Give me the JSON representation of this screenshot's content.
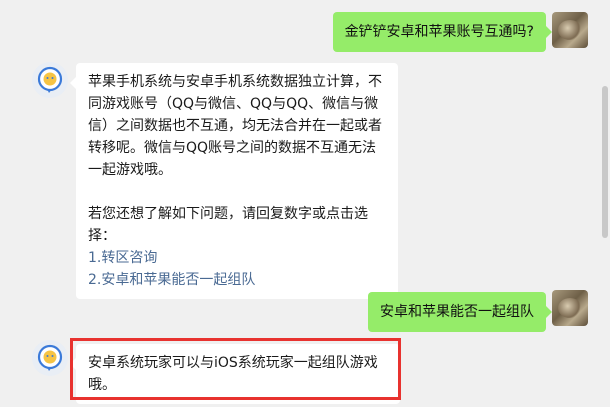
{
  "conversation": {
    "messages": [
      {
        "sender": "user",
        "text": "金铲铲安卓和苹果账号互通吗?"
      },
      {
        "sender": "bot",
        "paragraph": "苹果手机系统与安卓手机系统数据独立计算，不同游戏账号（QQ与微信、QQ与QQ、微信与微信）之间数据也不互通，均无法合并在一起或者转移呢。微信与QQ账号之间的数据不互通无法一起游戏哦。",
        "prompt": "若您还想了解如下问题，请回复数字或点击选择：",
        "options": [
          "1.转区咨询",
          "2.安卓和苹果能否一起组队"
        ]
      },
      {
        "sender": "user",
        "text": "安卓和苹果能否一起组队"
      },
      {
        "sender": "bot",
        "text": "安卓系统玩家可以与iOS系统玩家一起组队游戏哦。"
      }
    ]
  },
  "icons": {
    "bot_avatar": "bot-chat-bubble-icon",
    "user_avatar": "user-photo-avatar"
  },
  "colors": {
    "background": "#f0f0f0",
    "user_bubble": "#95ec69",
    "bot_bubble": "#ffffff",
    "link": "#4a6a93",
    "highlight": "#e8322f"
  }
}
